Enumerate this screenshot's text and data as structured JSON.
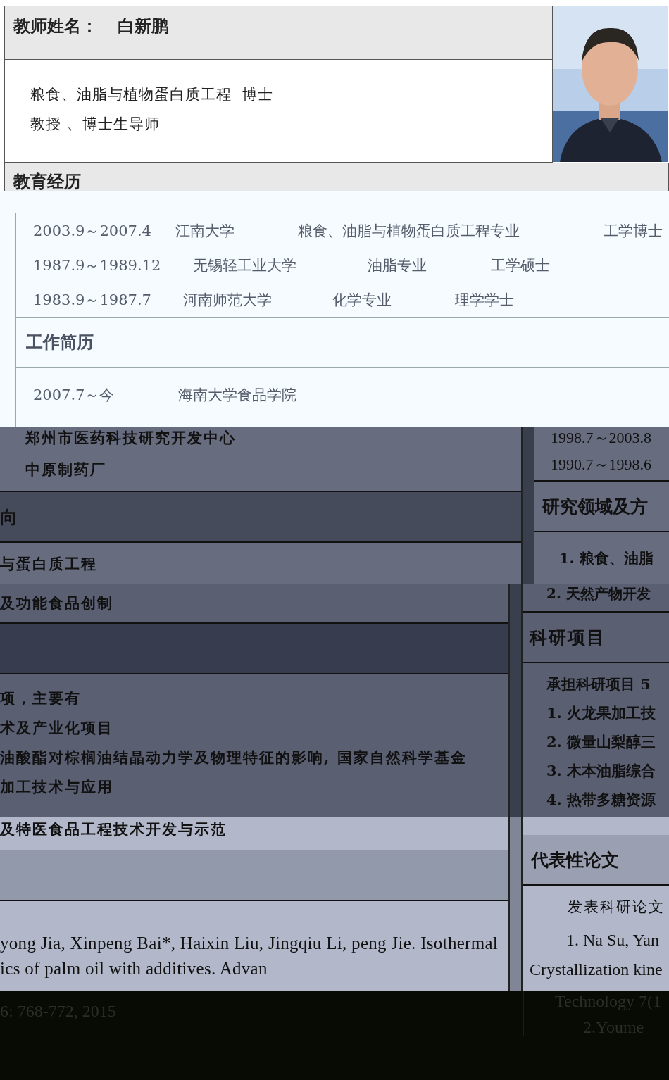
{
  "profile": {
    "name_label": "教师姓名：",
    "name": "白新鹏",
    "lines": [
      "粮食、油脂与植物蛋白质工程  博士",
      "教授 、博士生导师"
    ],
    "photo": {
      "kind": "picture"
    }
  },
  "education": {
    "heading": "教育经历",
    "rows": [
      [
        "2003.9～2007.4",
        "江南大学",
        "粮食、油脂与植物蛋白质工程专业",
        "工学博士"
      ],
      [
        "1987.9～1989.12",
        "无锡轻工业大学",
        "油脂专业",
        "工学硕士"
      ],
      [
        "1983.9～1987.7",
        "河南师范大学",
        "化学专业",
        "理学学士"
      ]
    ]
  },
  "work": {
    "heading": "工作简历",
    "rows": [
      [
        "2007.7～今",
        "海南大学食品学院"
      ]
    ]
  },
  "work_more": {
    "left": [
      "郑州市医药科技研究开发中心",
      "中原制药厂"
    ],
    "right": [
      "1998.7～2003.8",
      "1990.7～1998.6"
    ]
  },
  "research": {
    "left_heading": "向",
    "left_lines": [
      "与蛋白质工程",
      "及功能食品创制"
    ],
    "right_heading": "研究领域及方",
    "right_lines": [
      "1. 粮食、油脂",
      "2. 天然产物开发"
    ]
  },
  "projects": {
    "right_heading": "科研项目",
    "left_lines": [
      "项，主要有",
      "术及产业化项目",
      "油酸酯对棕榈油结晶动力学及物理特征的影响, 国家自然科学基金",
      "加工技术与应用",
      "及特医食品工程技术开发与示范"
    ],
    "right_lines": [
      "承担科研项目 5",
      "1. 火龙果加工技",
      "2. 微量山梨醇三",
      "3. 木本油脂综合",
      "4. 热带多糖资源"
    ]
  },
  "papers": {
    "right_heading": "代表性论文",
    "left_lines": [
      "yong Jia, Xinpeng Bai*, Haixin Liu, Jingqiu Li, peng Jie. Isothermal",
      "ics of palm oil with additives. Advan",
      "6: 768-772, 2015"
    ],
    "right_lines": [
      "发表科研论文",
      "1. Na Su, Yan",
      "Crystallization kine",
      "Technology 7(1",
      "2.Youme"
    ]
  }
}
